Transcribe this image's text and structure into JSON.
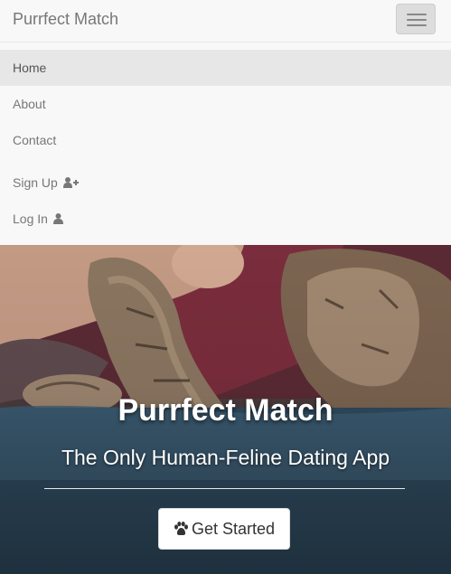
{
  "navbar": {
    "brand": "Purrfect Match",
    "toggle_icon": "hamburger-menu-icon"
  },
  "menu": {
    "items": [
      {
        "label": "Home",
        "active": true
      },
      {
        "label": "About"
      },
      {
        "label": "Contact"
      },
      {
        "label": "Sign Up",
        "icon": "user-plus-icon"
      },
      {
        "label": "Log In",
        "icon": "user-icon"
      }
    ]
  },
  "hero": {
    "title": "Purrfect Match",
    "subtitle": "The Only Human-Feline Dating App",
    "cta_label": "Get Started",
    "cta_icon": "paw-icon"
  },
  "colors": {
    "navbar_bg": "#f8f8f8",
    "active_item_bg": "#e7e7e7",
    "text_muted": "#777777"
  }
}
